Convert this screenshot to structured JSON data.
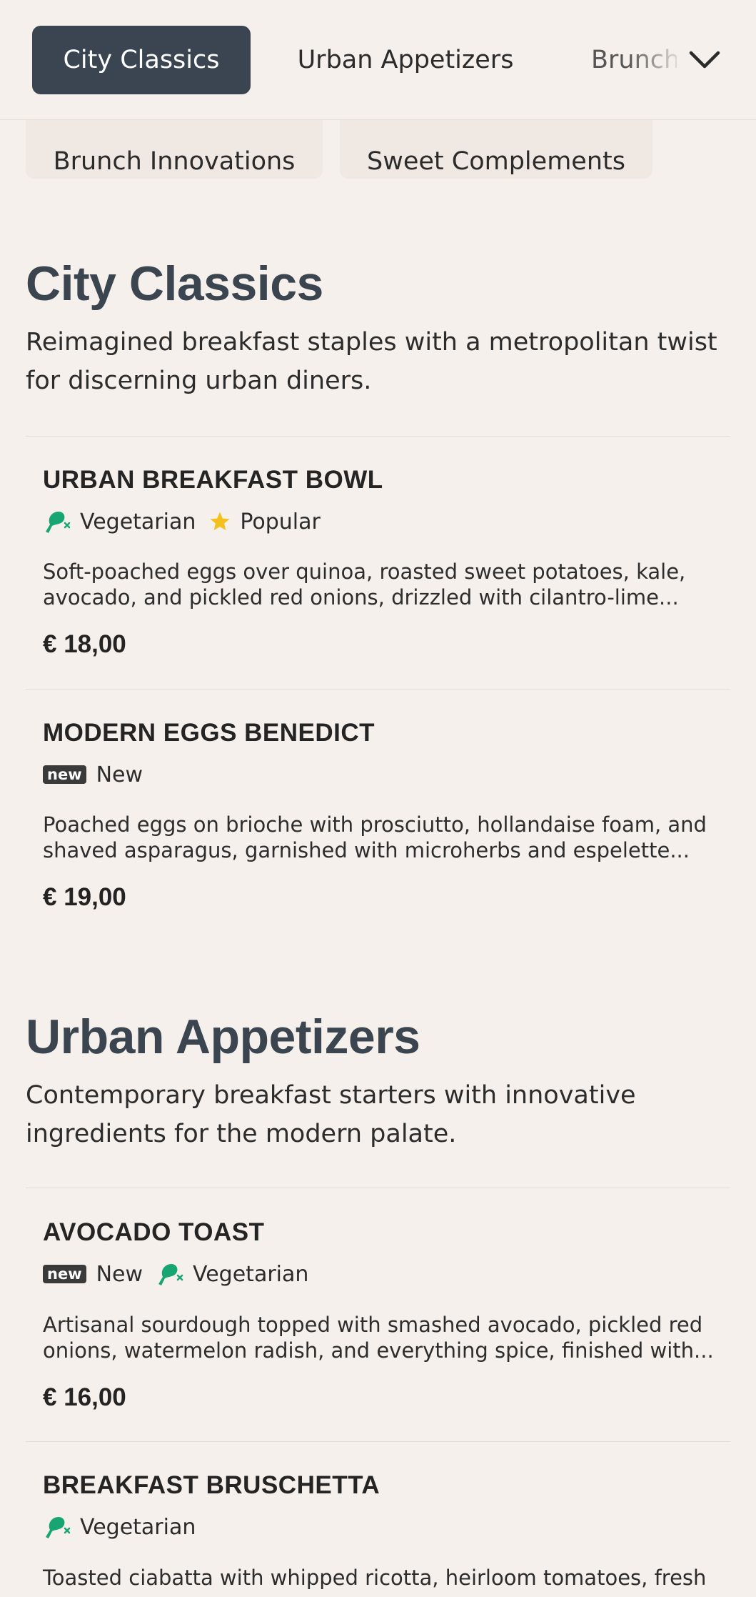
{
  "nav": {
    "tabs": [
      {
        "label": "City Classics",
        "active": true
      },
      {
        "label": "Urban Appetizers",
        "active": false
      },
      {
        "label": "Brunch Innovations",
        "active": false
      }
    ],
    "chips": [
      "Brunch Innovations",
      "Sweet Complements"
    ],
    "expand_icon": "chevron-down-icon"
  },
  "colors": {
    "active_tab_bg": "#3a4551",
    "vegetarian_green": "#17a673",
    "popular_star": "#f4c01e"
  },
  "sections": [
    {
      "title": "City Classics",
      "description": "Reimagined breakfast staples with a metropolitan twist for discerning urban diners.",
      "items": [
        {
          "name": "URBAN BREAKFAST BOWL",
          "tags": [
            "Vegetarian",
            "Popular"
          ],
          "description": "Soft-poached eggs over quinoa, roasted sweet potatoes, kale, avocado, and pickled red onions, drizzled with cilantro-lime...",
          "price": "€ 18,00"
        },
        {
          "name": "MODERN EGGS BENEDICT",
          "tags": [
            "New"
          ],
          "badge": "new",
          "description": "Poached eggs on brioche with prosciutto, hollandaise foam, and shaved asparagus, garnished with microherbs and espelette...",
          "price": "€ 19,00"
        }
      ]
    },
    {
      "title": "Urban Appetizers",
      "description": "Contemporary breakfast starters with innovative ingredients for the modern palate.",
      "items": [
        {
          "name": "AVOCADO TOAST",
          "tags": [
            "New",
            "Vegetarian"
          ],
          "badge": "new",
          "description": "Artisanal sourdough topped with smashed avocado, pickled red onions, watermelon radish, and everything spice, finished with...",
          "price": "€ 16,00"
        },
        {
          "name": "BREAKFAST BRUSCHETTA",
          "tags": [
            "Vegetarian"
          ],
          "description": "Toasted ciabatta with whipped ricotta, heirloom tomatoes, fresh"
        }
      ]
    }
  ]
}
